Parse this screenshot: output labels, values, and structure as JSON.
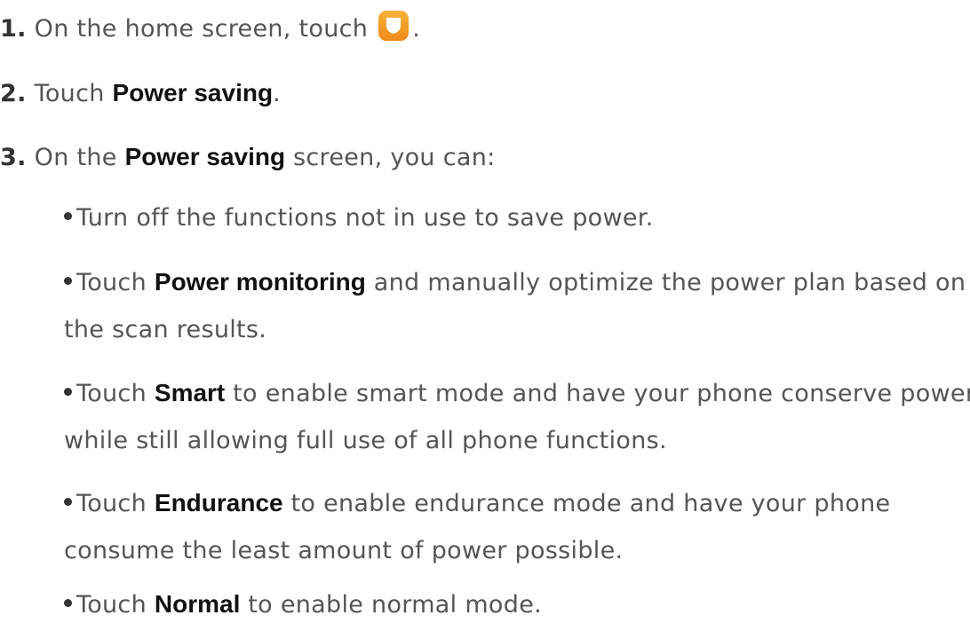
{
  "steps": [
    {
      "number": "1.",
      "text_before": "On the home screen, touch",
      "icon": "phone-manager-shield-icon",
      "text_after": "."
    },
    {
      "number": "2.",
      "text_before": "Touch",
      "bold": "Power saving",
      "text_after": "."
    },
    {
      "number": "3.",
      "text_before": "On the",
      "bold": "Power saving",
      "text_after": "screen, you can:"
    }
  ],
  "bullets": [
    {
      "line1": "Turn off the functions not in use to save power."
    },
    {
      "before": "Touch",
      "bold": "Power monitoring",
      "after": "and manually optimize the power plan based on",
      "line2": "the scan results."
    },
    {
      "before": "Touch",
      "bold": "Smart",
      "after": "to enable smart mode and have your phone conserve power",
      "line2": "while still allowing full use of all phone functions."
    },
    {
      "before": "Touch",
      "bold": "Endurance",
      "after": "to enable endurance mode and have your phone",
      "line2": "consume the least amount of power possible."
    },
    {
      "before": "Touch",
      "bold": "Normal",
      "after": "to enable normal mode."
    }
  ],
  "colors": {
    "icon_orange": "#f29a26",
    "body_text": "#555555",
    "bold_text": "#111111"
  }
}
